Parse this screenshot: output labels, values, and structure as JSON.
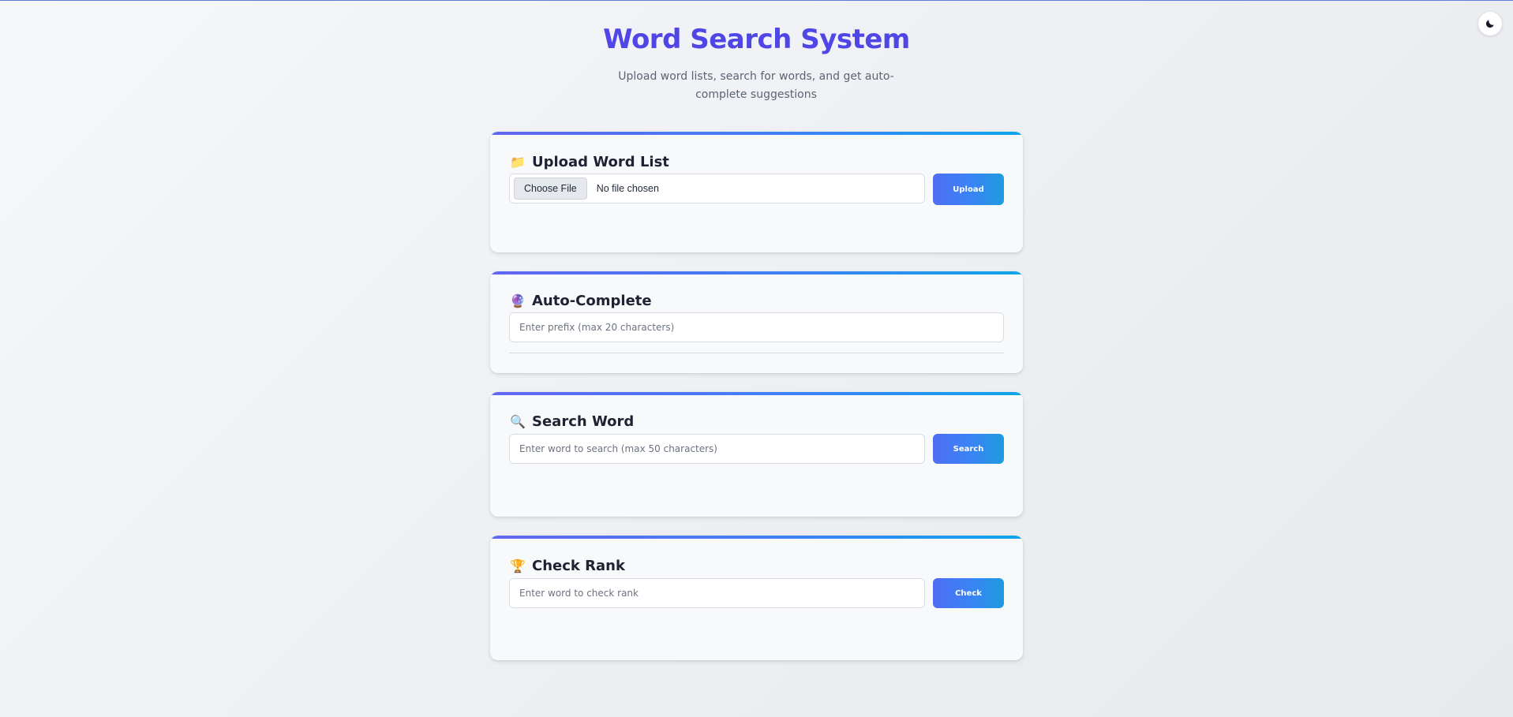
{
  "header": {
    "title": "Word Search System",
    "subtitle": "Upload word lists, search for words, and get auto-complete suggestions"
  },
  "theme_toggle": {
    "icon": "moon-icon"
  },
  "upload_card": {
    "emoji": "📁",
    "icon": "folder-icon",
    "title": "Upload Word List",
    "choose_label": "Choose File",
    "file_status": "No file chosen",
    "button_label": "Upload"
  },
  "autocomplete_card": {
    "emoji": "🔮",
    "icon": "crystal-ball-icon",
    "title": "Auto-Complete",
    "placeholder": "Enter prefix (max 20 characters)",
    "value": ""
  },
  "search_card": {
    "emoji": "🔍",
    "icon": "magnifier-icon",
    "title": "Search Word",
    "placeholder": "Enter word to search (max 50 characters)",
    "value": "",
    "button_label": "Search"
  },
  "rank_card": {
    "emoji": "🏆",
    "icon": "trophy-icon",
    "title": "Check Rank",
    "placeholder": "Enter word to check rank",
    "value": "",
    "button_label": "Check"
  },
  "colors": {
    "title": "#4f46e5",
    "accent_start": "#6366f1",
    "accent_end": "#0ea5e9",
    "button": "#3b82f6"
  }
}
